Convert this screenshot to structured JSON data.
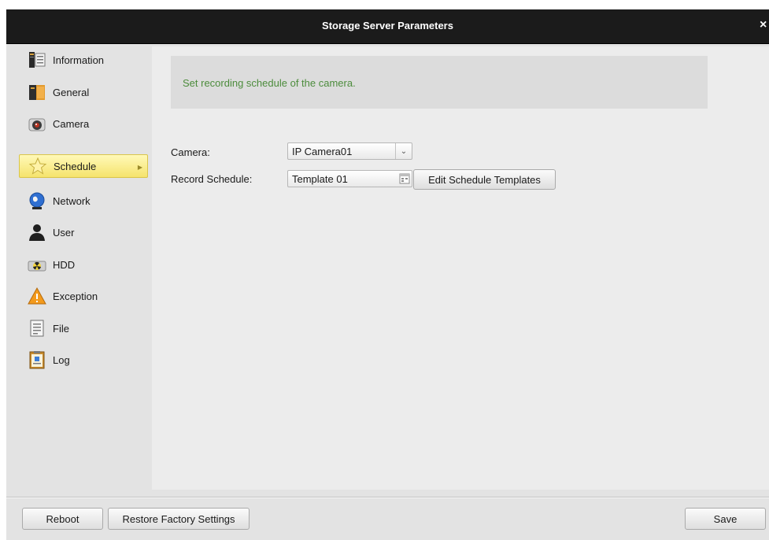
{
  "window": {
    "title": "Storage Server Parameters",
    "close_label": "×"
  },
  "sidebar": {
    "items": [
      {
        "label": "Information",
        "icon": "information-icon",
        "selected": false
      },
      {
        "label": "General",
        "icon": "general-icon",
        "selected": false
      },
      {
        "label": "Camera",
        "icon": "camera-icon",
        "selected": false
      },
      {
        "label": "Schedule",
        "icon": "star-icon",
        "selected": true
      },
      {
        "label": "Network",
        "icon": "globe-icon",
        "selected": false
      },
      {
        "label": "User",
        "icon": "user-icon",
        "selected": false
      },
      {
        "label": "HDD",
        "icon": "hdd-icon",
        "selected": false
      },
      {
        "label": "Exception",
        "icon": "warning-icon",
        "selected": false
      },
      {
        "label": "File",
        "icon": "file-icon",
        "selected": false
      },
      {
        "label": "Log",
        "icon": "log-icon",
        "selected": false
      }
    ]
  },
  "main": {
    "info_text": "Set recording schedule of the camera.",
    "camera_label": "Camera:",
    "camera_value": "IP Camera01",
    "record_schedule_label": "Record Schedule:",
    "record_schedule_value": "Template 01",
    "edit_templates_label": "Edit Schedule Templates"
  },
  "footer": {
    "reboot_label": "Reboot",
    "restore_label": "Restore Factory Settings",
    "save_label": "Save"
  },
  "colors": {
    "titlebar": "#1b1b1b",
    "info_text": "#4c8c3c",
    "selected_item": "#f5e36c"
  }
}
